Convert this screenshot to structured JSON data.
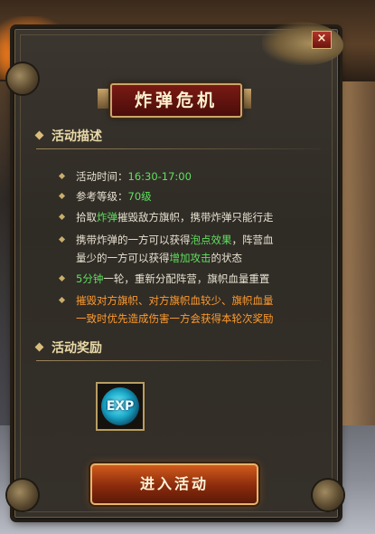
{
  "dialog": {
    "title": "炸弹危机",
    "close_label": "×",
    "sections": {
      "description": "活动描述",
      "rewards": "活动奖励"
    },
    "items": [
      {
        "prefix": "活动时间：",
        "highlight": "16:30-17:00",
        "suffix": ""
      },
      {
        "prefix": "参考等级：",
        "highlight": "70级",
        "suffix": ""
      },
      {
        "prefix": "拾取",
        "highlight": "炸弹",
        "suffix": "摧毁敌方旗帜，携带炸弹只能行走"
      },
      {
        "line1_prefix": "携带炸弹的一方可以获得",
        "line1_highlight": "泡点效果",
        "line1_suffix": "，阵营血",
        "line2_prefix": "量少的一方可以获得",
        "line2_highlight": "增加攻击",
        "line2_suffix": "的状态"
      },
      {
        "highlight": "5分钟",
        "suffix": "一轮，重新分配阵营，旗帜血量重置"
      },
      {
        "line1": "摧毁对方旗帜、对方旗帜血较少、旗帜血量",
        "line2": "一致时优先造成伤害一方会获得本轮次奖励"
      }
    ],
    "reward_icon_label": "EXP",
    "enter_button": "进入活动"
  },
  "colors": {
    "highlight_green": "#5fe05f",
    "highlight_orange": "#ff9b2e",
    "text": "#e8e2d2",
    "gold": "#caa56a"
  },
  "icons": [
    "close-icon",
    "exp-icon",
    "section-diamond-icon",
    "bullet-diamond-icon"
  ]
}
